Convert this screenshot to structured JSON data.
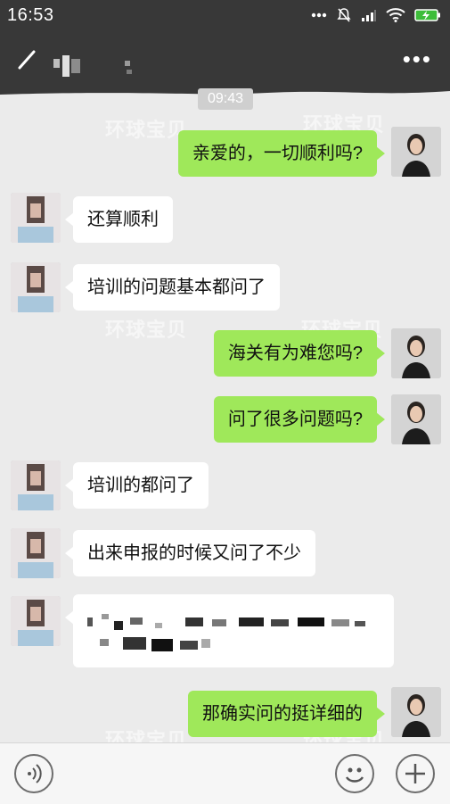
{
  "status_bar": {
    "time": "16:53",
    "battery": "charging"
  },
  "header": {
    "more_icon": "•••"
  },
  "timestamp": "09:43",
  "messages": [
    {
      "side": "me",
      "text": "亲爱的，一切顺利吗?"
    },
    {
      "side": "them",
      "text": "还算顺利"
    },
    {
      "side": "them",
      "text": "培训的问题基本都问了"
    },
    {
      "side": "me",
      "text": "海关有为难您吗?"
    },
    {
      "side": "me",
      "text": "问了很多问题吗?"
    },
    {
      "side": "them",
      "text": "培训的都问了"
    },
    {
      "side": "them",
      "text": "出来申报的时候又问了不少"
    },
    {
      "side": "them",
      "text": ""
    },
    {
      "side": "me",
      "text": "那确实问的挺详细的"
    }
  ],
  "colors": {
    "my_bubble": "#9fe85a",
    "their_bubble": "#ffffff",
    "header": "#383838",
    "chat_bg": "#ebebeb"
  },
  "icons": {
    "back": "back-arrow-icon",
    "voice": "voice-icon",
    "emoji": "emoji-icon",
    "plus": "plus-icon"
  }
}
